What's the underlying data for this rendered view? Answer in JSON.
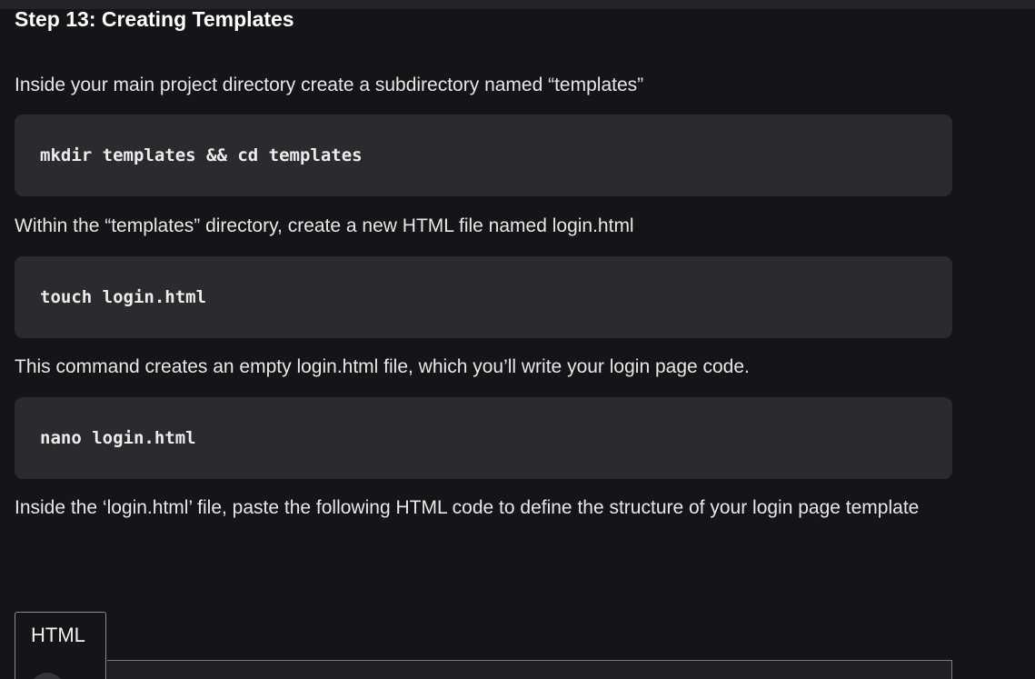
{
  "heading": "Step 13: Creating Templates",
  "paragraphs": {
    "p1": "Inside your main project directory create a subdirectory named “templates”",
    "p2": "Within the “templates” directory, create a new HTML file named login.html",
    "p3": "This command creates an empty login.html file, which you’ll write your login page code.",
    "p4": "Inside the ‘login.html’ file, paste the following HTML code to define the structure of your login page template"
  },
  "code_blocks": {
    "c1": "mkdir templates && cd templates",
    "c2": "touch login.html",
    "c3": "nano login.html"
  },
  "code_tabs": {
    "active": "HTML"
  }
}
